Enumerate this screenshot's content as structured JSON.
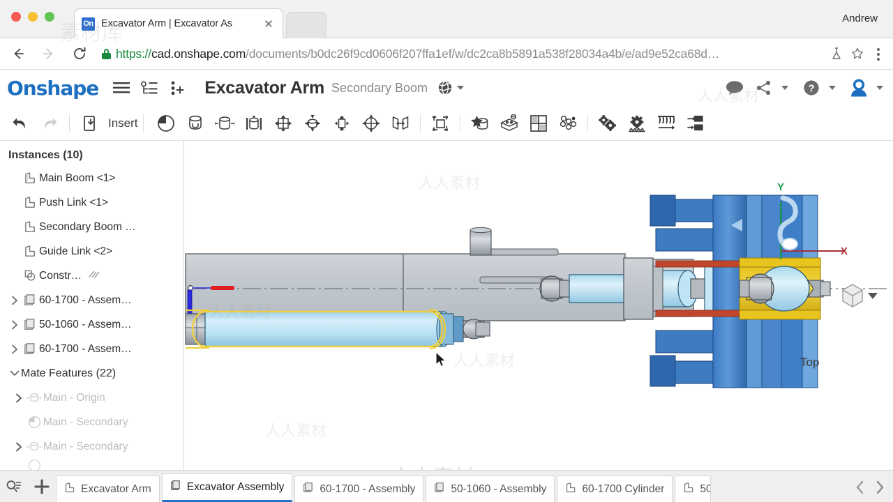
{
  "browser": {
    "tab": {
      "favicon_text": "On",
      "title": "Excavator Arm | Excavator As",
      "close_icon": "close-icon"
    },
    "profile_name": "Andrew",
    "url": {
      "scheme": "https://",
      "host": "cad.onshape.com",
      "path": "/documents/b0dc26f9cd0606f207ffa1ef/w/dc2ca8b5891a538f28034a4b/e/ad9e52ca68d…"
    },
    "nav": {
      "back": "back-icon",
      "forward": "forward-icon",
      "reload": "reload-icon"
    },
    "right_icons": {
      "flask": "flask-icon",
      "bookmark": "bookmark-star-icon",
      "menu": "browser-menu-icon"
    }
  },
  "onshape_header": {
    "logo": "Onshape",
    "menu_icon": "hamburger-menu-icon",
    "versions_icon": "version-graph-icon",
    "branch_icon": "create-version-icon",
    "document_title": "Excavator Arm",
    "workspace_name": "Secondary Boom",
    "globe_icon": "globe-public-icon",
    "right": {
      "comment_icon": "comment-icon",
      "share_icon": "share-icon",
      "help_icon": "help-icon",
      "account_icon": "account-avatar-icon"
    }
  },
  "toolbar": {
    "undo_label": "undo-icon",
    "redo_label": "redo-icon",
    "insert_label": "Insert",
    "items": [
      {
        "name": "assembly-pattern-pie-icon"
      },
      {
        "name": "fastened-mate-icon"
      },
      {
        "name": "revolute-mate-icon"
      },
      {
        "name": "slider-mate-icon"
      },
      {
        "name": "planar-mate-icon"
      },
      {
        "name": "cylindrical-mate-icon"
      },
      {
        "name": "pin-slot-mate-icon"
      },
      {
        "name": "ball-mate-icon"
      },
      {
        "name": "parallel-mate-icon"
      },
      {
        "name": "mate-connector-icon"
      },
      {
        "name": "group-icon"
      },
      {
        "name": "replicate-icon"
      },
      {
        "name": "transform-icon"
      },
      {
        "name": "pattern-grid-icon"
      },
      {
        "name": "explode-icon"
      },
      {
        "name": "gear-relation-icon"
      },
      {
        "name": "rack-pinion-icon"
      },
      {
        "name": "screw-relation-icon"
      },
      {
        "name": "linear-relation-icon"
      }
    ]
  },
  "instances_panel": {
    "header": "Instances (10)",
    "rows": [
      {
        "label": "Main Boom <1>",
        "icon": "part-icon",
        "arrow": "none",
        "dim": false
      },
      {
        "label": "Push Link <1>",
        "icon": "part-icon",
        "arrow": "none",
        "dim": false
      },
      {
        "label": "Secondary Boom …",
        "icon": "part-icon",
        "arrow": "none",
        "dim": false
      },
      {
        "label": "Guide Link <2>",
        "icon": "part-icon",
        "arrow": "none",
        "dim": false
      },
      {
        "label": "Constr…",
        "icon": "construction-icon",
        "arrow": "none",
        "dim": false,
        "hatch": true
      },
      {
        "label": "60-1700 - Assem…",
        "icon": "assembly-icon",
        "arrow": "right",
        "dim": false
      },
      {
        "label": "50-1060 - Assem…",
        "icon": "assembly-icon",
        "arrow": "right",
        "dim": false
      },
      {
        "label": "60-1700 - Assem…",
        "icon": "assembly-icon",
        "arrow": "right",
        "dim": false
      }
    ],
    "mate_header": "Mate Features (22)",
    "mate_header_arrow": "down",
    "mate_rows": [
      {
        "label": "Main - Origin",
        "icon": "revolute-mate-icon",
        "arrow": "right",
        "dim": true
      },
      {
        "label": "Main - Secondary",
        "icon": "pie-mate-icon",
        "arrow": "none",
        "dim": true
      },
      {
        "label": "Main - Secondary",
        "icon": "revolute-mate-icon",
        "arrow": "right",
        "dim": true
      }
    ]
  },
  "viewport": {
    "view_orientation_label": "Top",
    "axis_x_label": "X",
    "axis_y_label": "Y",
    "view_cube_icon": "view-cube-icon",
    "view_cube_caret": "chevron-down-icon",
    "colors": {
      "boom_gray": "#c5cad0",
      "cylinder_blue": "#b9e0f2",
      "bracket_blue": "#3f7fc8",
      "plate_yellow": "#e8c41f",
      "plate_red": "#c0472c",
      "highlight_yellow": "#f2d03c",
      "axis_x": "#a52f3a",
      "axis_y": "#1d9a4f",
      "origin_blue": "#2a2adf",
      "origin_red": "#e02020"
    }
  },
  "watermarks": [
    "人人素材",
    "人人素材",
    "人人素材",
    "人人素材",
    "人人素材",
    "人人素材"
  ],
  "bottom_bar": {
    "search_icon": "element-search-icon",
    "add_icon": "add-tab-icon",
    "tabs": [
      {
        "label": "Excavator Arm",
        "icon": "part-studio-icon",
        "active": false
      },
      {
        "label": "Excavator Assembly",
        "icon": "assembly-icon",
        "active": true
      },
      {
        "label": "60-1700 - Assembly",
        "icon": "assembly-icon",
        "active": false
      },
      {
        "label": "50-1060 - Assembly",
        "icon": "assembly-icon",
        "active": false
      },
      {
        "label": "60-1700 Cylinder",
        "icon": "part-studio-icon",
        "active": false
      },
      {
        "label": "50-",
        "icon": "part-studio-icon",
        "active": false
      }
    ],
    "nav_prev": "chevron-left-icon",
    "nav_next": "chevron-right-icon"
  }
}
